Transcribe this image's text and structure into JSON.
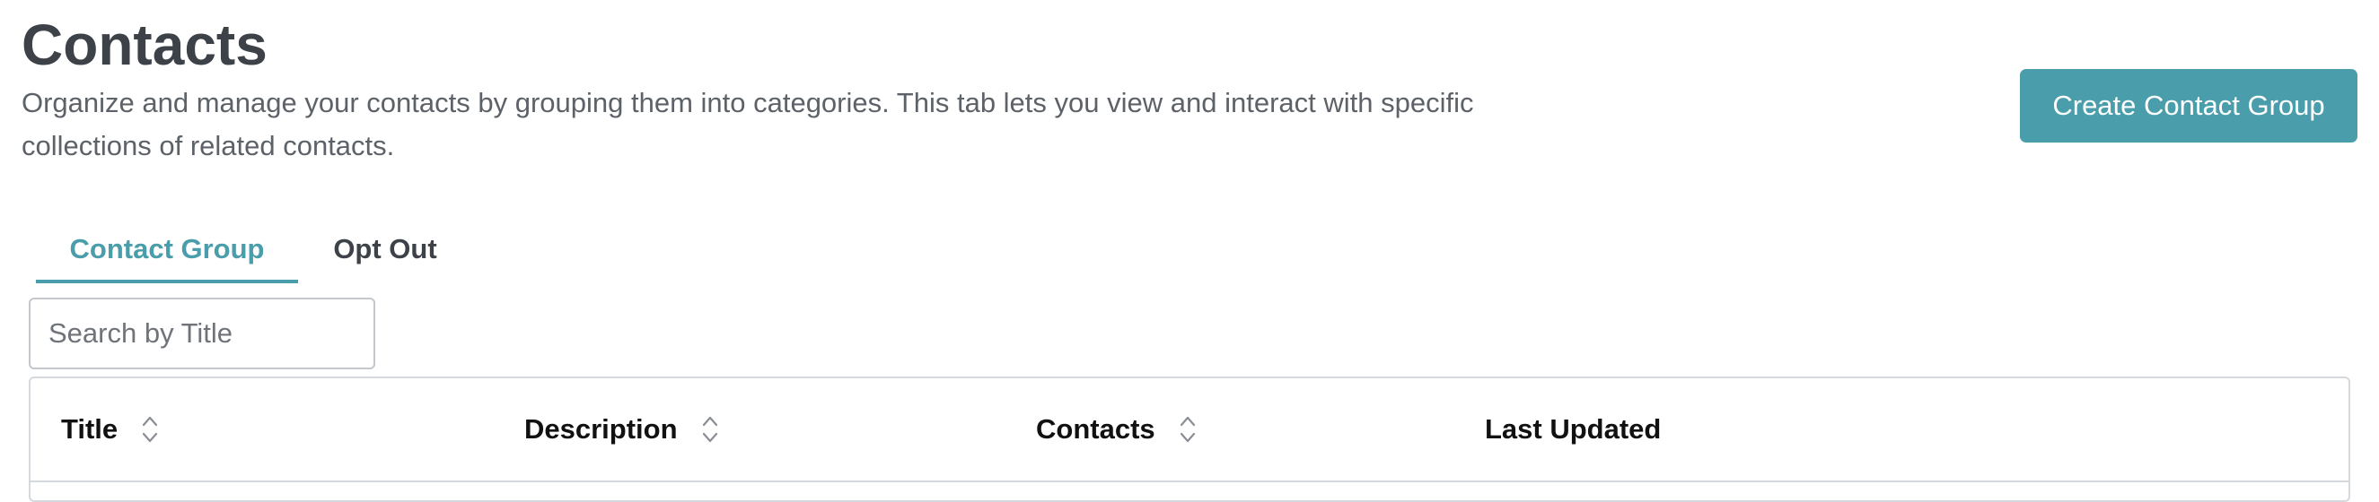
{
  "header": {
    "title": "Contacts",
    "description": "Organize and manage your contacts by grouping them into categories. This tab lets you view and interact with specific collections of related contacts.",
    "create_button_label": "Create Contact Group"
  },
  "tabs": [
    {
      "label": "Contact Group",
      "active": true
    },
    {
      "label": "Opt Out",
      "active": false
    }
  ],
  "search": {
    "placeholder": "Search by Title",
    "value": ""
  },
  "table": {
    "columns": [
      {
        "label": "Title",
        "sortable": true,
        "icon": "sort-icon"
      },
      {
        "label": "Description",
        "sortable": true,
        "icon": "sort-icon"
      },
      {
        "label": "Contacts",
        "sortable": true,
        "icon": "sort-icon"
      },
      {
        "label": "Last Updated",
        "sortable": false
      }
    ]
  },
  "colors": {
    "accent": "#4a9daa",
    "title_text": "#3d4249",
    "body_text": "#5d6269",
    "border": "#d5d8dc"
  }
}
